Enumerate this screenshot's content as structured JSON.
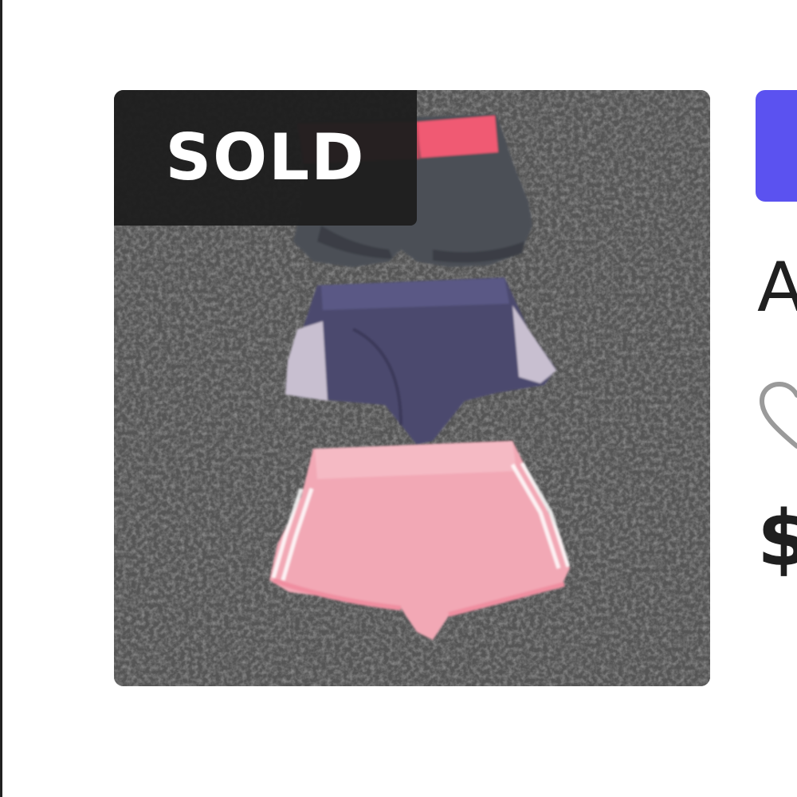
{
  "listing": {
    "status_badge": "SOLD",
    "title_visible": "A",
    "price_visible": "$",
    "like_icon": "heart-outline-icon",
    "photo_subject": "three-shorts-on-carpet"
  },
  "colors": {
    "badge_bg": "#1e1e1e",
    "badge_text": "#ffffff",
    "accent_button": "#5b52f0",
    "text": "#1f1f1f",
    "icon_outline": "#9a9a9a",
    "carpet": "#5b5b5b",
    "shorts_grey": "#4a4e55",
    "shorts_navy": "#4a4a6c",
    "shorts_pink": "#f3a9b6",
    "waistband_pink": "#f0566f"
  }
}
